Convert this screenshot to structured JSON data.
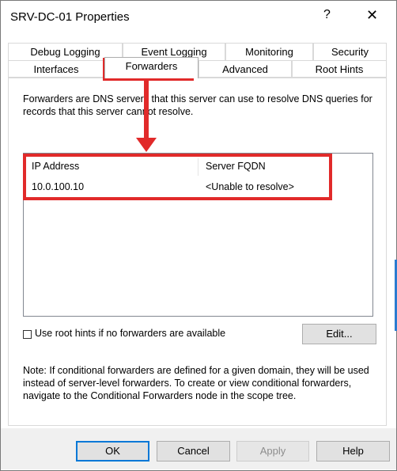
{
  "window": {
    "title": "SRV-DC-01 Properties",
    "help_glyph": "?",
    "close_glyph": "✕"
  },
  "tabs": {
    "row1": [
      {
        "label": "Debug Logging"
      },
      {
        "label": "Event Logging"
      },
      {
        "label": "Monitoring"
      },
      {
        "label": "Security"
      }
    ],
    "row2": [
      {
        "label": "Interfaces"
      },
      {
        "label": "Forwarders",
        "active": true
      },
      {
        "label": "Advanced"
      },
      {
        "label": "Root Hints"
      }
    ]
  },
  "forwarders": {
    "description": "Forwarders are DNS servers that this server can use to resolve DNS queries for records that this server cannot resolve.",
    "columns": [
      "IP Address",
      "Server FQDN"
    ],
    "rows": [
      {
        "ip": "10.0.100.10",
        "fqdn": "<Unable to resolve>"
      }
    ],
    "use_root_hints": {
      "label": "Use root hints if no forwarders are available",
      "checked": false
    },
    "edit_label": "Edit...",
    "note": "Note: If conditional forwarders are defined for a given domain, they will be used instead of server-level forwarders.  To create or view conditional forwarders, navigate to the Conditional Forwarders node in the scope tree."
  },
  "buttons": {
    "ok": "OK",
    "cancel": "Cancel",
    "apply": "Apply",
    "help": "Help"
  },
  "annotation_color": "#e12a2a"
}
